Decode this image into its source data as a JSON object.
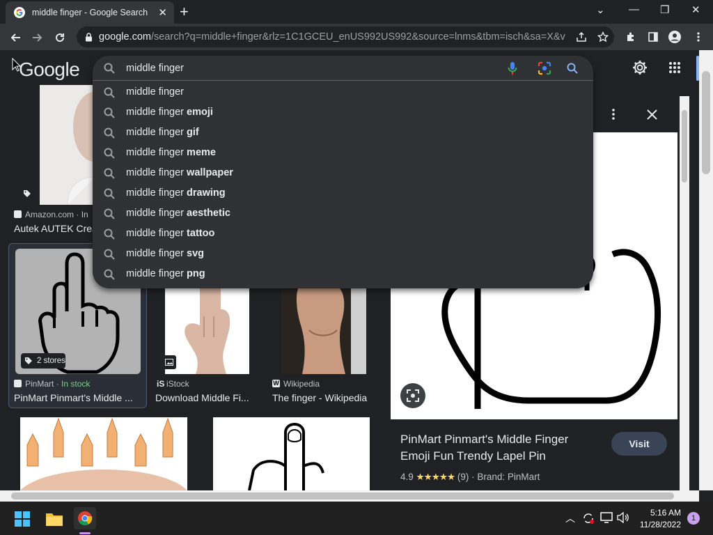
{
  "browser": {
    "tab_title": "middle finger - Google Search",
    "url_host": "google.com",
    "url_rest": "/search?q=middle+finger&rlz=1C1GCEU_enUS992US992&source=lnms&tbm=isch&sa=X&ved..."
  },
  "google": {
    "logo": "Google",
    "query": "middle finger",
    "suggestions": [
      {
        "base": "middle finger",
        "bold": ""
      },
      {
        "base": "middle finger ",
        "bold": "emoji"
      },
      {
        "base": "middle finger ",
        "bold": "gif"
      },
      {
        "base": "middle finger ",
        "bold": "meme"
      },
      {
        "base": "middle finger ",
        "bold": "wallpaper"
      },
      {
        "base": "middle finger ",
        "bold": "drawing"
      },
      {
        "base": "middle finger ",
        "bold": "aesthetic"
      },
      {
        "base": "middle finger ",
        "bold": "tattoo"
      },
      {
        "base": "middle finger ",
        "bold": "svg"
      },
      {
        "base": "middle finger ",
        "bold": "png"
      }
    ]
  },
  "results": {
    "r1": {
      "source": "Amazon.com · In",
      "title": "Autek AUTEK Crea"
    },
    "r2": {
      "badge": "2 stores",
      "source": "PinMart",
      "status": "· In stock",
      "title": "PinMart Pinmart's Middle ..."
    },
    "r3": {
      "source": "iStock",
      "title": "Download Middle Fi..."
    },
    "r4": {
      "source": "Wikipedia",
      "title": "The finger - Wikipedia"
    }
  },
  "panel": {
    "title_line1": "PinMart Pinmart's Middle Finger",
    "title_line2": "Emoji Fun Trendy Lapel Pin",
    "rating": "4.9",
    "stars": "★★★★★",
    "reviews": "(9)",
    "sep": "·",
    "brand": "Brand: PinMart",
    "visit": "Visit"
  },
  "taskbar": {
    "time": "5:16 AM",
    "date": "11/28/2022",
    "notif_count": "1"
  }
}
